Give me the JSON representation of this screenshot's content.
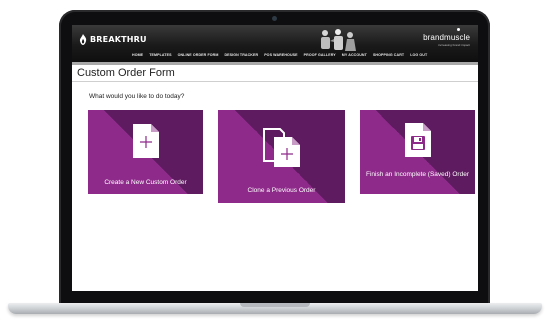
{
  "brand": {
    "name": "BREAKTHRU"
  },
  "partner": {
    "name": "brandmuscle",
    "tagline": "increasing brand impact"
  },
  "nav": {
    "items": [
      {
        "label": "HOME"
      },
      {
        "label": "TEMPLATES"
      },
      {
        "label": "ONLINE ORDER FORM"
      },
      {
        "label": "DESIGN TRACKER"
      },
      {
        "label": "POS WAREHOUSE"
      },
      {
        "label": "PROOF GALLERY"
      },
      {
        "label": "MY ACCOUNT"
      },
      {
        "label": "SHOPPING CART"
      },
      {
        "label": "LOG OUT"
      }
    ]
  },
  "page": {
    "title": "Custom Order Form",
    "prompt": "What would you like to do today?"
  },
  "options": [
    {
      "label": "Create a New Custom Order",
      "icon": "new-document-icon"
    },
    {
      "label": "Clone a Previous Order",
      "icon": "clone-document-icon"
    },
    {
      "label": "Finish an Incomplete (Saved) Order",
      "icon": "saved-document-icon"
    }
  ],
  "colors": {
    "card_primary": "#8e2a8a",
    "card_dark": "#5e1b5f",
    "header_bg": "#1a1a1a"
  }
}
